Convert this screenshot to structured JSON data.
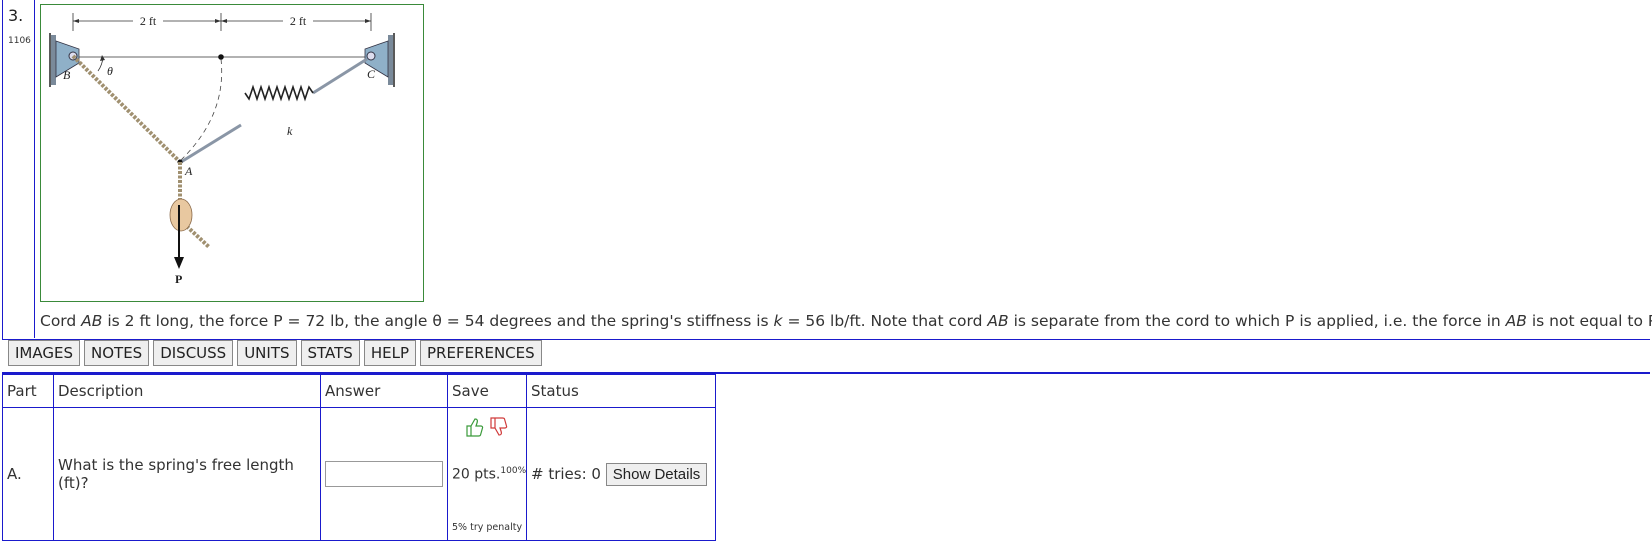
{
  "question": {
    "number": "3.",
    "id": "1106",
    "figure_labels": {
      "dim_left": "2 ft",
      "dim_right": "2 ft",
      "point_b": "B",
      "point_c": "C",
      "point_a": "A",
      "theta": "θ",
      "spring_k": "k",
      "force_p": "P"
    },
    "statement": {
      "s1": "Cord ",
      "ab1": "AB",
      "s2": " is 2 ft long, the force P = 72 lb, the angle θ = 54 degrees and the spring's stiffness is ",
      "k": "k",
      "s3": " = 56 lb/ft. Note that cord ",
      "ab2": "AB",
      "s4": " is separate from the cord to which P is applied, i.e. the force in ",
      "ab3": "AB",
      "s5": " is not equal to P."
    }
  },
  "toolbar": {
    "buttons": [
      "IMAGES",
      "NOTES",
      "DISCUSS",
      "UNITS",
      "STATS",
      "HELP",
      "PREFERENCES"
    ]
  },
  "table": {
    "headers": {
      "part": "Part",
      "description": "Description",
      "answer": "Answer",
      "save": "Save",
      "status": "Status"
    },
    "rows": [
      {
        "part": "A.",
        "description": "What is the spring's free length (ft)?",
        "answer_value": "",
        "points": "20 pts.",
        "percent": "100%",
        "penalty": "5% try penalty",
        "tries_label": "# tries: 0",
        "show_details": "Show Details"
      }
    ]
  },
  "colors": {
    "border_blue": "#1a1acc",
    "figure_border": "#3a8a3a",
    "thumb_up": "#3a9a3a",
    "thumb_down": "#d03a3a"
  }
}
